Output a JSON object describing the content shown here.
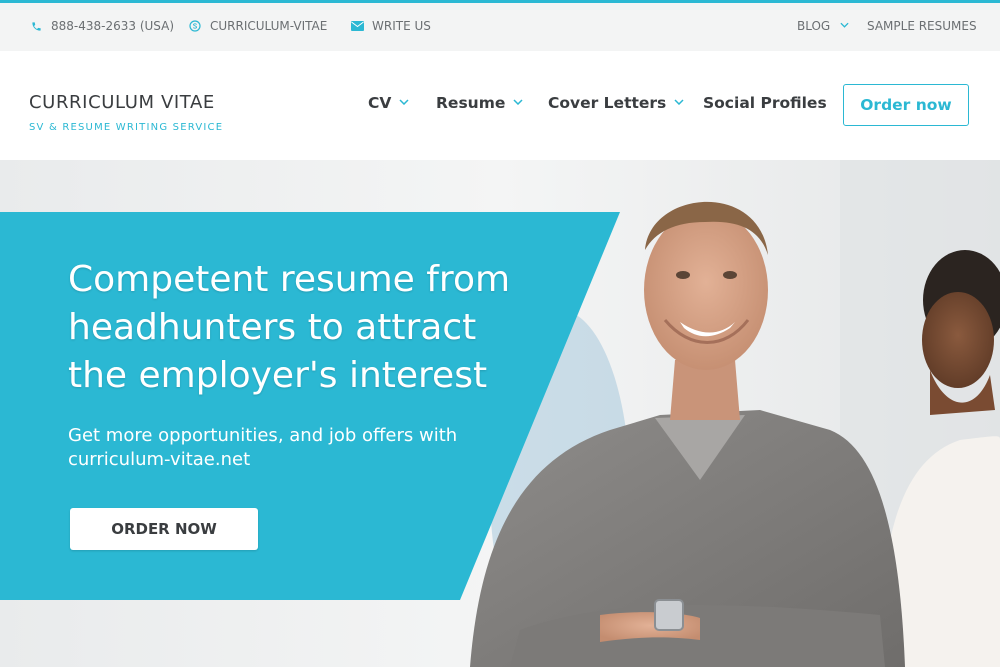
{
  "topbar": {
    "phone": "888-438-2633 (USA)",
    "skype": "CURRICULUM-VITAE",
    "write_us": "WRITE US",
    "blog": "BLOG",
    "sample_resumes": "SAMPLE RESUMES",
    "icons": {
      "phone": "phone-icon",
      "skype": "skype-icon",
      "mail": "mail-icon",
      "dropdown": "chevron-down-icon"
    }
  },
  "brand": {
    "title": "CURRICULUM VITAE",
    "subtitle": "SV & RESUME WRITING SERVICE"
  },
  "nav": {
    "items": [
      {
        "label": "CV",
        "has_dropdown": true
      },
      {
        "label": "Resume",
        "has_dropdown": true
      },
      {
        "label": "Cover Letters",
        "has_dropdown": true
      },
      {
        "label": "Social Profiles",
        "has_dropdown": false
      }
    ],
    "order_button": "Order now"
  },
  "hero": {
    "title": "Competent resume from headhunters to attract the employer's interest",
    "subtitle": "Get more opportunities, and job offers with curriculum-vitae.net",
    "cta": "ORDER NOW"
  },
  "colors": {
    "accent": "#2bb8d3",
    "text_dark": "#3a3d40",
    "topbar_bg": "#f3f4f4"
  }
}
